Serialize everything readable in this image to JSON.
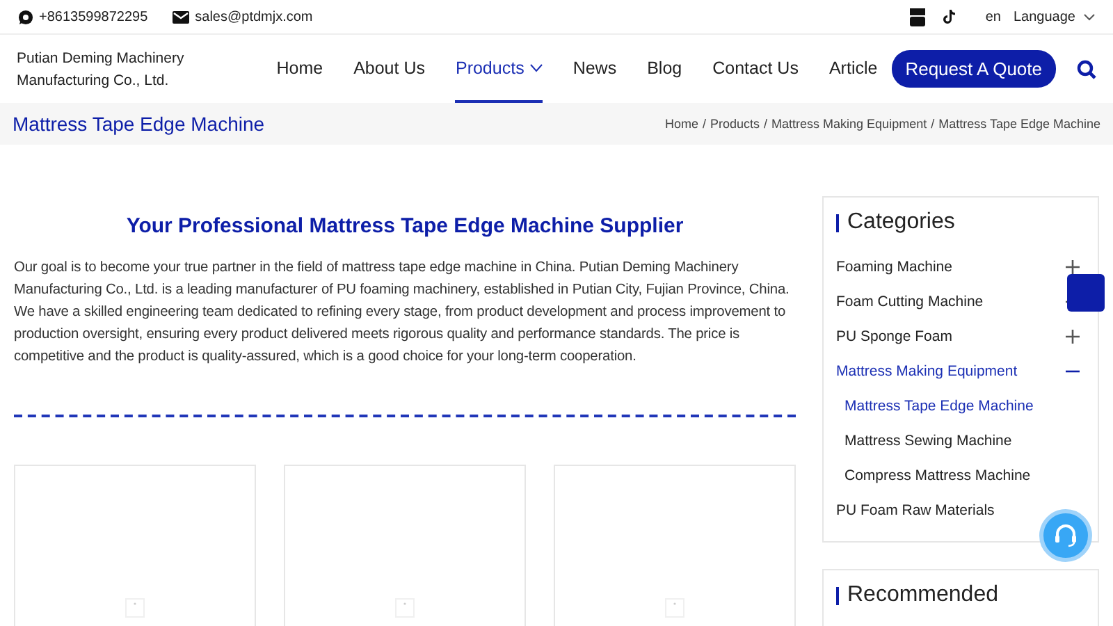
{
  "topbar": {
    "phone": "+8613599872295",
    "email": "sales@ptdmjx.com",
    "language_code": "en",
    "language": "Language"
  },
  "header": {
    "company": "Putian Deming Machinery Manufacturing Co., Ltd.",
    "nav": [
      {
        "label": "Home",
        "selected": false,
        "dropdown": false
      },
      {
        "label": "About Us",
        "selected": false,
        "dropdown": false
      },
      {
        "label": "Products",
        "selected": true,
        "dropdown": true
      },
      {
        "label": "News",
        "selected": false,
        "dropdown": false
      },
      {
        "label": "Blog",
        "selected": false,
        "dropdown": false
      },
      {
        "label": "Contact Us",
        "selected": false,
        "dropdown": false
      },
      {
        "label": "Article",
        "selected": false,
        "dropdown": false
      }
    ],
    "quote_button": "Request A Quote"
  },
  "page_title": "Mattress Tape Edge Machine",
  "breadcrumb": [
    "Home",
    "Products",
    "Mattress Making Equipment",
    "Mattress Tape Edge Machine"
  ],
  "breadcrumb_separator": "/",
  "main": {
    "heading": "Your Professional Mattress Tape Edge Machine Supplier",
    "intro": "Our goal is to become your true partner in the field of mattress tape edge machine in China. Putian Deming Machinery Manufacturing Co., Ltd. is a leading manufacturer of PU foaming machinery, established in Putian City, Fujian Province, China. We have a skilled engineering team dedicated to refining every stage, from product development and process improvement to production oversight, ensuring every product delivered meets rigorous quality and performance standards. The price is competitive and the product is quality-assured, which is a good choice for your long-term cooperation.",
    "product_cards": [
      {
        "kind": "placeholder"
      },
      {
        "kind": "placeholder"
      },
      {
        "kind": "placeholder"
      }
    ]
  },
  "sidebar": {
    "categories_title": "Categories",
    "categories": [
      {
        "label": "Foaming Machine",
        "selected": false,
        "expanded": false
      },
      {
        "label": "Foam Cutting Machine",
        "selected": false,
        "expanded": false
      },
      {
        "label": "PU Sponge Foam",
        "selected": false,
        "expanded": false
      },
      {
        "label": "Mattress Making Equipment",
        "selected": true,
        "expanded": true,
        "children": [
          {
            "label": "Mattress Tape Edge Machine",
            "selected": true
          },
          {
            "label": "Mattress Sewing Machine",
            "selected": false
          },
          {
            "label": "Compress Mattress Machine",
            "selected": false
          }
        ]
      },
      {
        "label": "PU Foam Raw Materials",
        "selected": false
      }
    ],
    "recommended_title": "Recommended"
  }
}
